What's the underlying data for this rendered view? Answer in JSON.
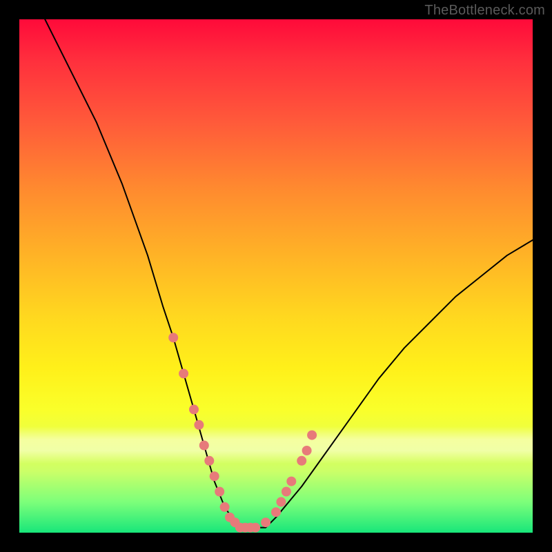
{
  "watermark": "TheBottleneck.com",
  "chart_data": {
    "type": "line",
    "title": "",
    "xlabel": "",
    "ylabel": "",
    "xlim": [
      0,
      100
    ],
    "ylim": [
      0,
      100
    ],
    "grid": false,
    "series": [
      {
        "name": "bottleneck-curve",
        "x": [
          5,
          10,
          15,
          20,
          25,
          28,
          30,
          32,
          34,
          36,
          38,
          40,
          42,
          44,
          46,
          48,
          50,
          55,
          60,
          65,
          70,
          75,
          80,
          85,
          90,
          95,
          100
        ],
        "values": [
          100,
          90,
          80,
          68,
          54,
          44,
          38,
          31,
          24,
          17,
          10,
          5,
          2,
          1,
          1,
          1,
          3,
          9,
          16,
          23,
          30,
          36,
          41,
          46,
          50,
          54,
          57
        ]
      }
    ],
    "markers": {
      "name": "highlight-points",
      "color": "#e77a7a",
      "x": [
        30,
        32,
        34,
        35,
        36,
        37,
        38,
        39,
        40,
        41,
        42,
        43,
        44,
        45,
        46,
        48,
        50,
        51,
        52,
        53,
        55,
        56,
        57
      ],
      "values": [
        38,
        31,
        24,
        21,
        17,
        14,
        11,
        8,
        5,
        3,
        2,
        1,
        1,
        1,
        1,
        2,
        4,
        6,
        8,
        10,
        14,
        16,
        19
      ]
    },
    "background": {
      "type": "vertical-gradient",
      "stops": [
        {
          "pos": 0,
          "color": "#ff0a3a"
        },
        {
          "pos": 50,
          "color": "#ffd81f"
        },
        {
          "pos": 100,
          "color": "#18e67a"
        }
      ]
    }
  }
}
